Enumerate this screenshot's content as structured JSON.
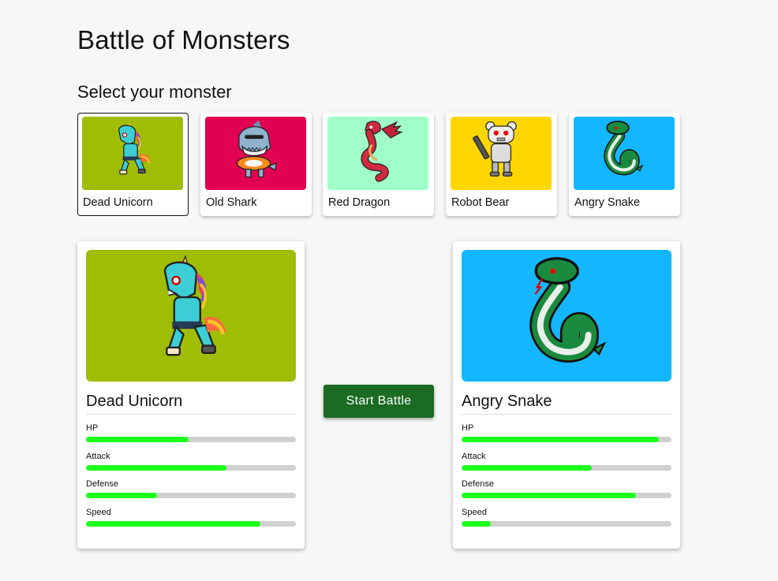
{
  "page": {
    "title": "Battle of Monsters",
    "subtitle": "Select your monster"
  },
  "monsters": [
    {
      "name": "Dead Unicorn",
      "bg": "#a0bd06",
      "icon": "zombie-unicorn-icon",
      "selected": true
    },
    {
      "name": "Old Shark",
      "bg": "#e10051",
      "icon": "shark-icon",
      "selected": false
    },
    {
      "name": "Red Dragon",
      "bg": "#a0ffc8",
      "icon": "dragon-icon",
      "selected": false
    },
    {
      "name": "Robot Bear",
      "bg": "#ffd700",
      "icon": "robot-bear-icon",
      "selected": false
    },
    {
      "name": "Angry Snake",
      "bg": "#14b7ff",
      "icon": "snake-icon",
      "selected": false
    }
  ],
  "player": {
    "name": "Dead Unicorn",
    "bg": "#a0bd06",
    "stats": [
      {
        "label": "HP",
        "value": 0.49
      },
      {
        "label": "Attack",
        "value": 0.67
      },
      {
        "label": "Defense",
        "value": 0.34
      },
      {
        "label": "Speed",
        "value": 0.83
      }
    ]
  },
  "computer": {
    "name": "Angry Snake",
    "bg": "#14b7ff",
    "stats": [
      {
        "label": "HP",
        "value": 0.94
      },
      {
        "label": "Attack",
        "value": 0.62
      },
      {
        "label": "Defense",
        "value": 0.83
      },
      {
        "label": "Speed",
        "value": 0.14
      }
    ]
  },
  "battle": {
    "start_label": "Start Battle"
  },
  "colors": {
    "button": "#1b6b23",
    "stat_fill": "#1cff1c",
    "stat_track": "#d0d0d0"
  }
}
